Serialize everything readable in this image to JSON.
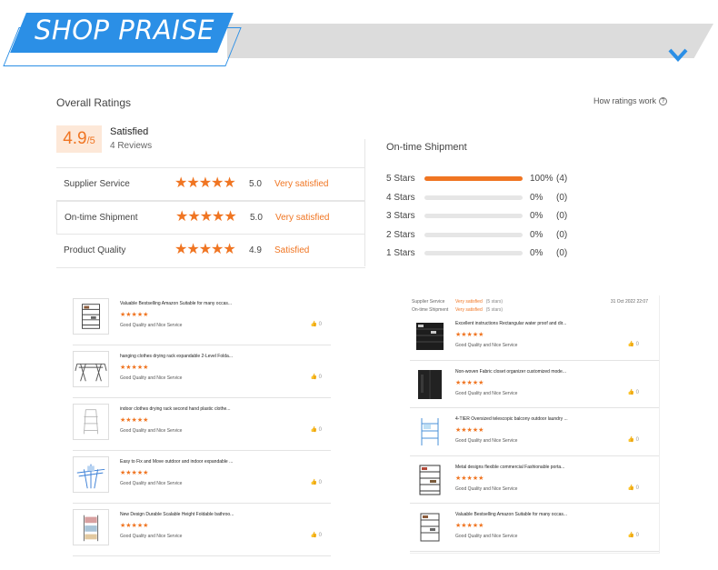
{
  "banner": {
    "title": "SHOP PRAISE",
    "chevron_icon": "chevron-down-icon"
  },
  "ratings": {
    "title": "Overall Ratings",
    "how_link": "How ratings work",
    "help_icon": "question-circle-icon",
    "score": "4.9",
    "score_out_of": "/5",
    "level": "Satisfied",
    "reviews": "4 Reviews",
    "rows": [
      {
        "label": "Supplier Service",
        "stars": "★★★★★",
        "value": "5.0",
        "status": "Very satisfied"
      },
      {
        "label": "On-time Shipment",
        "stars": "★★★★★",
        "value": "5.0",
        "status": "Very satisfied"
      },
      {
        "label": "Product Quality",
        "stars": "★★★★★",
        "value": "4.9",
        "status": "Satisfied"
      }
    ],
    "shipment": {
      "title": "On-time Shipment",
      "bars": [
        {
          "label": "5 Stars",
          "fraction": 1.0,
          "pct": "100%",
          "count": "(4)"
        },
        {
          "label": "4 Stars",
          "fraction": 0,
          "pct": "0%",
          "count": "(0)"
        },
        {
          "label": "3 Stars",
          "fraction": 0,
          "pct": "0%",
          "count": "(0)"
        },
        {
          "label": "2 Stars",
          "fraction": 0,
          "pct": "0%",
          "count": "(0)"
        },
        {
          "label": "1 Stars",
          "fraction": 0,
          "pct": "0%",
          "count": "(0)"
        }
      ]
    }
  },
  "left_list": {
    "items": [
      {
        "name": "Valuable Bestselling Amazon Suitable for many occas...",
        "stars": "★★★★★",
        "comment": "Good Quality and Nice Service",
        "likes": "0",
        "thumb": "shoe-rack-image"
      },
      {
        "name": "hanging clothes drying rack expandable 2-Level Folda...",
        "stars": "★★★★★",
        "comment": "Good Quality and Nice Service",
        "likes": "0",
        "thumb": "drying-rack-image"
      },
      {
        "name": "indoor clothes drying rack second hand plastic clothe...",
        "stars": "★★★★★",
        "comment": "Good Quality and Nice Service",
        "likes": "0",
        "thumb": "clothes-rack-image"
      },
      {
        "name": "Easy to Fix and Move outdoor and indoor expandable ...",
        "stars": "★★★★★",
        "comment": "Good Quality and Nice Service",
        "likes": "0",
        "thumb": "expandable-rack-image"
      },
      {
        "name": "New Design Durable Scalable Height Foldable bathroo...",
        "stars": "★★★★★",
        "comment": "Good Quality and Nice Service",
        "likes": "0",
        "thumb": "towel-rack-image"
      }
    ]
  },
  "right_list": {
    "header": {
      "k1": "Supplier Service",
      "v1": "Very satisfied",
      "s1": "(5 stars)",
      "k2": "On-time Shipment",
      "v2": "Very satisfied",
      "s2": "(5 stars)",
      "date": "31 Oct 2022 22:07"
    },
    "items": [
      {
        "name": "Excellent instructions Rectangular water proof and dir...",
        "stars": "★★★★★",
        "comment": "Good Quality and Nice Service",
        "likes": "0",
        "thumb": "shoe-cabinet-image"
      },
      {
        "name": "Non-woven Fabric closet organizer customized mode...",
        "stars": "★★★★★",
        "comment": "Good Quality and Nice Service",
        "likes": "0",
        "thumb": "fabric-closet-image"
      },
      {
        "name": "4-TIER Oversized telescopic balcony outdoor laundry ...",
        "stars": "★★★★★",
        "comment": "Good Quality and Nice Service",
        "likes": "0",
        "thumb": "laundry-rack-image"
      },
      {
        "name": "Metal designs flexible commercial Fashionable porta...",
        "stars": "★★★★★",
        "comment": "Good Quality and Nice Service",
        "likes": "0",
        "thumb": "shoe-tower-image"
      },
      {
        "name": "Valuable Bestselling Amazon Suitable for many occas...",
        "stars": "★★★★★",
        "comment": "Good Quality and Nice Service",
        "likes": "0",
        "thumb": "shoe-rack-image"
      }
    ]
  },
  "colors": {
    "accent": "#f07522",
    "banner_blue": "#2b8fe6",
    "banner_gray": "#dcdcdc"
  }
}
